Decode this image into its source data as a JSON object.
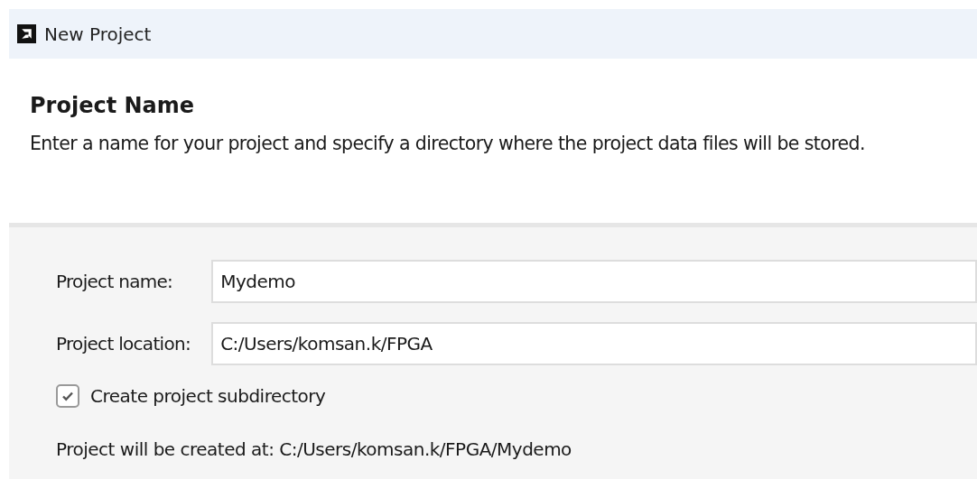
{
  "window": {
    "title": "New Project"
  },
  "page": {
    "heading": "Project Name",
    "description": "Enter a name for your project and specify a directory where the project data files will be stored."
  },
  "form": {
    "fields": [
      {
        "label": "Project name:",
        "value": "Mydemo"
      },
      {
        "label": "Project location:",
        "value": "C:/Users/komsan.k/FPGA"
      }
    ],
    "checkbox": {
      "label": "Create project subdirectory",
      "checked": true
    },
    "result": "Project will be created at: C:/Users/komsan.k/FPGA/Mydemo"
  }
}
